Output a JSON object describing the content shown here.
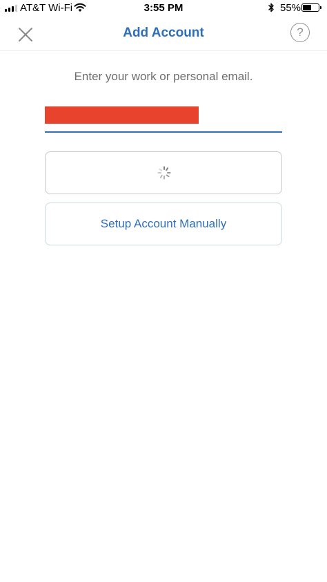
{
  "status_bar": {
    "carrier": "AT&T Wi-Fi",
    "time": "3:55 PM",
    "battery_percent": "55%",
    "battery_level": 0.55,
    "signal_bars": 3,
    "icons": [
      "signal-bars-icon",
      "wifi-icon",
      "bluetooth-icon",
      "battery-icon"
    ]
  },
  "nav": {
    "title": "Add Account",
    "close_icon": "close-icon",
    "help_label": "?"
  },
  "form": {
    "prompt": "Enter your work or personal email.",
    "email_state": "redacted",
    "next_button_state": "loading",
    "manual_button_label": "Setup Account Manually"
  },
  "colors": {
    "accent": "#2f6fb6",
    "redaction": "#e8432d",
    "muted_text": "#6d6d6d",
    "border": "#c9c9c9"
  }
}
